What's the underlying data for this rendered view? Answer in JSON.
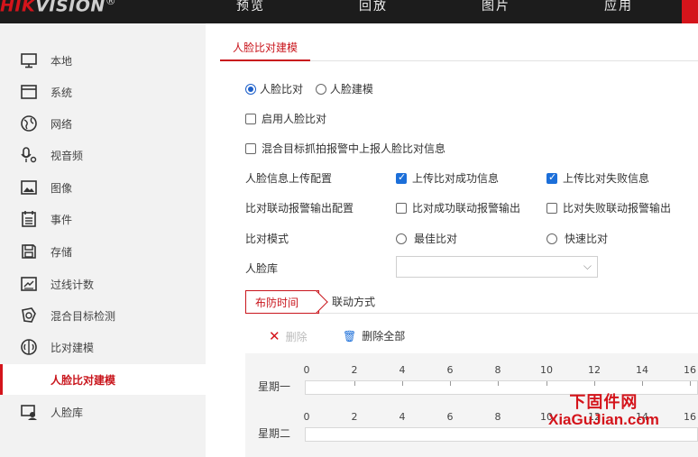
{
  "brand": {
    "logo_red": "HIK",
    "logo_gray": "VISION",
    "registered": "®"
  },
  "nav": [
    "预览",
    "回放",
    "图片",
    "应用"
  ],
  "sidebar": {
    "items": [
      {
        "label": "本地",
        "icon": "monitor-icon"
      },
      {
        "label": "系统",
        "icon": "window-icon"
      },
      {
        "label": "网络",
        "icon": "globe-icon"
      },
      {
        "label": "视音频",
        "icon": "microphone-icon"
      },
      {
        "label": "图像",
        "icon": "image-icon"
      },
      {
        "label": "事件",
        "icon": "event-list-icon"
      },
      {
        "label": "存储",
        "icon": "storage-icon"
      },
      {
        "label": "过线计数",
        "icon": "line-count-icon"
      },
      {
        "label": "混合目标检测",
        "icon": "target-detect-icon"
      },
      {
        "label": "比对建模",
        "icon": "compare-model-icon"
      },
      {
        "label": "人脸比对建模",
        "icon": "",
        "active": true
      },
      {
        "label": "人脸库",
        "icon": "face-library-icon"
      }
    ]
  },
  "main": {
    "tab": "人脸比对建模",
    "mode_radio": {
      "option1": "人脸比对",
      "option2": "人脸建模",
      "selected": "人脸比对"
    },
    "enable_face_compare": "启用人脸比对",
    "upload_mixed": "混合目标抓拍报警中上报人脸比对信息",
    "upload_config": {
      "label": "人脸信息上传配置",
      "opt_success": "上传比对成功信息",
      "opt_fail": "上传比对失败信息"
    },
    "alarm_output": {
      "label": "比对联动报警输出配置",
      "opt_success": "比对成功联动报警输出",
      "opt_fail": "比对失败联动报警输出"
    },
    "compare_mode": {
      "label": "比对模式",
      "opt_best": "最佳比对",
      "opt_fast": "快速比对"
    },
    "face_library": {
      "label": "人脸库",
      "value": ""
    },
    "subtabs": {
      "schedule": "布防时间",
      "linkage": "联动方式"
    },
    "actions": {
      "delete": "删除",
      "delete_all": "删除全部"
    },
    "schedule": {
      "ticks": [
        "0",
        "2",
        "4",
        "6",
        "8",
        "10",
        "12",
        "14",
        "16"
      ],
      "days": [
        "星期一",
        "星期二"
      ]
    }
  },
  "watermark": {
    "line1": "下固件网",
    "line2": "XiaGuJian.com"
  },
  "colors": {
    "brand_red": "#d4141b",
    "accent_blue": "#1c6fd9",
    "topbar": "#1c1c1c"
  }
}
